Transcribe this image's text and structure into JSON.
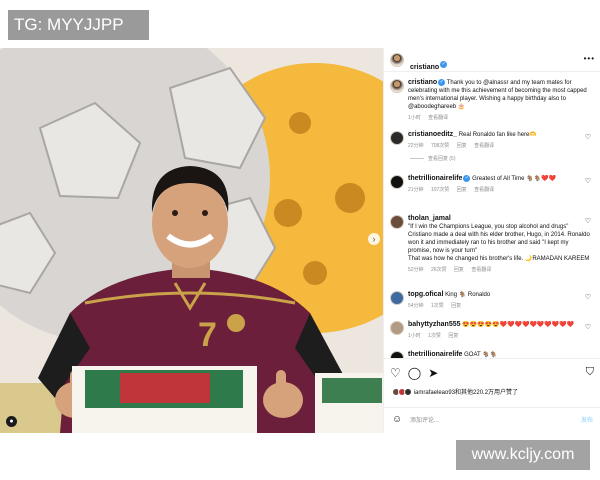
{
  "watermark_top": "TG: MYYJJPP",
  "watermark_bottom": "www.kcljy.com",
  "post": {
    "author": "cristiano",
    "caption": {
      "user": "cristiano",
      "text": "Thank you to @alnassr and my team mates for celebrating with me this achievement of becoming the most capped men's international player. Wishing a happy birthday also to @aboodeghareeb 🎂",
      "time": "1小时",
      "see_translation": "查看翻译"
    },
    "comments": [
      {
        "user": "cristianoeditz_",
        "text": "Real Ronaldo fan like here🫶",
        "time": "22分钟",
        "likes": "708次赞",
        "reply": "回复",
        "translate": "查看翻译",
        "more": "查看回复 (5)"
      },
      {
        "user": "thetrillionairelife",
        "text": "Greatest of All Time 🐐🐐❤️❤️",
        "time": "21分钟",
        "likes": "107次赞",
        "reply": "回复",
        "translate": "查看翻译",
        "more": ""
      },
      {
        "user": "tholan_jamal",
        "text": "\"If I win the Champions League, you stop alcohol and drugs\"\nCristiano made a deal with his elder brother, Hugo, in 2014. Ronaldo won it and immediately ran to his brother and said \"I kept my promise, now is your turn\"\nThat was how he changed his brother's life. 🌙RAMADAN KAREEM",
        "time": "52分钟",
        "likes": "26次赞",
        "reply": "回复",
        "translate": "查看翻译",
        "more": ""
      },
      {
        "user": "topg.ofical",
        "text": "King 🐐 Ronaldo",
        "time": "54分钟",
        "likes": "1次赞",
        "reply": "回复",
        "translate": "",
        "more": ""
      },
      {
        "user": "bahyttyzhan555",
        "text": "😍😍😍😍😍❤️❤️❤️❤️❤️❤️❤️❤️❤️❤️",
        "time": "1小时",
        "likes": "1次赞",
        "reply": "回复",
        "translate": "",
        "more": ""
      },
      {
        "user": "thetrillionairelife",
        "text": "GOAT 🐐🐐",
        "time": "",
        "likes": "",
        "reply": "",
        "translate": "",
        "more": ""
      }
    ],
    "likes_text": "iamrafaeleao93和其他220.2万用户赞了",
    "add_comment_placeholder": "添加评论...",
    "post_button": "发布"
  },
  "icons": {
    "heart": "heart-icon",
    "comment": "comment-icon",
    "share": "share-icon",
    "save": "bookmark-icon",
    "emoji": "emoji-icon",
    "more": "more-icon"
  },
  "colors": {
    "verified": "#3897f0",
    "post_link": "#b2dffc",
    "jersey": "#6b1f3a",
    "background_yellow": "#f4b93d"
  }
}
